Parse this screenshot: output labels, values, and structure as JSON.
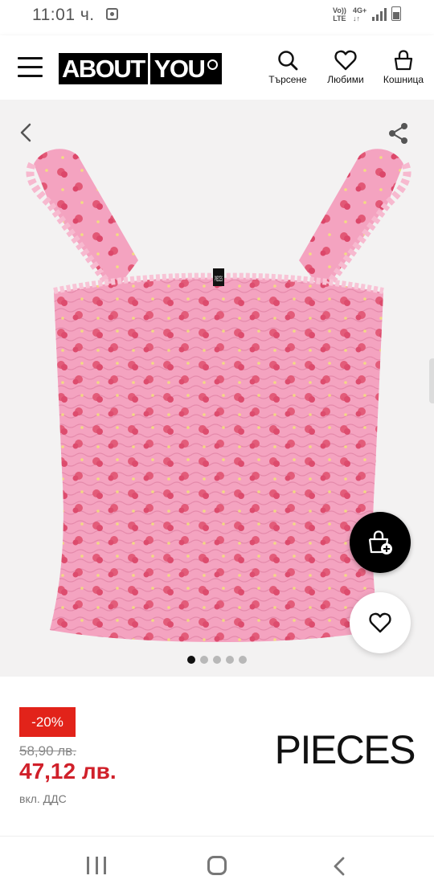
{
  "status_bar": {
    "time": "11:01 ч.",
    "volte_top": "Vo))",
    "volte_bottom": "LTE",
    "network_top": "4G+",
    "network_bottom": "↓↑"
  },
  "header": {
    "logo_part1": "ABOUT",
    "logo_part2": "YOU",
    "actions": {
      "search": "Търсене",
      "favorites": "Любими",
      "cart": "Кошница"
    }
  },
  "gallery": {
    "total_images": 5,
    "active_index": 0
  },
  "product": {
    "discount": "-20%",
    "old_price": "58,90 лв.",
    "new_price": "47,12 лв.",
    "vat_note": "вкл. ДДС",
    "brand": "PIECES",
    "tag_text": "PIECES"
  },
  "colors": {
    "accent_red": "#d0202a",
    "badge_red": "#e2231a",
    "product_pink": "#f4a3c0",
    "flower_red": "#e0506e"
  }
}
